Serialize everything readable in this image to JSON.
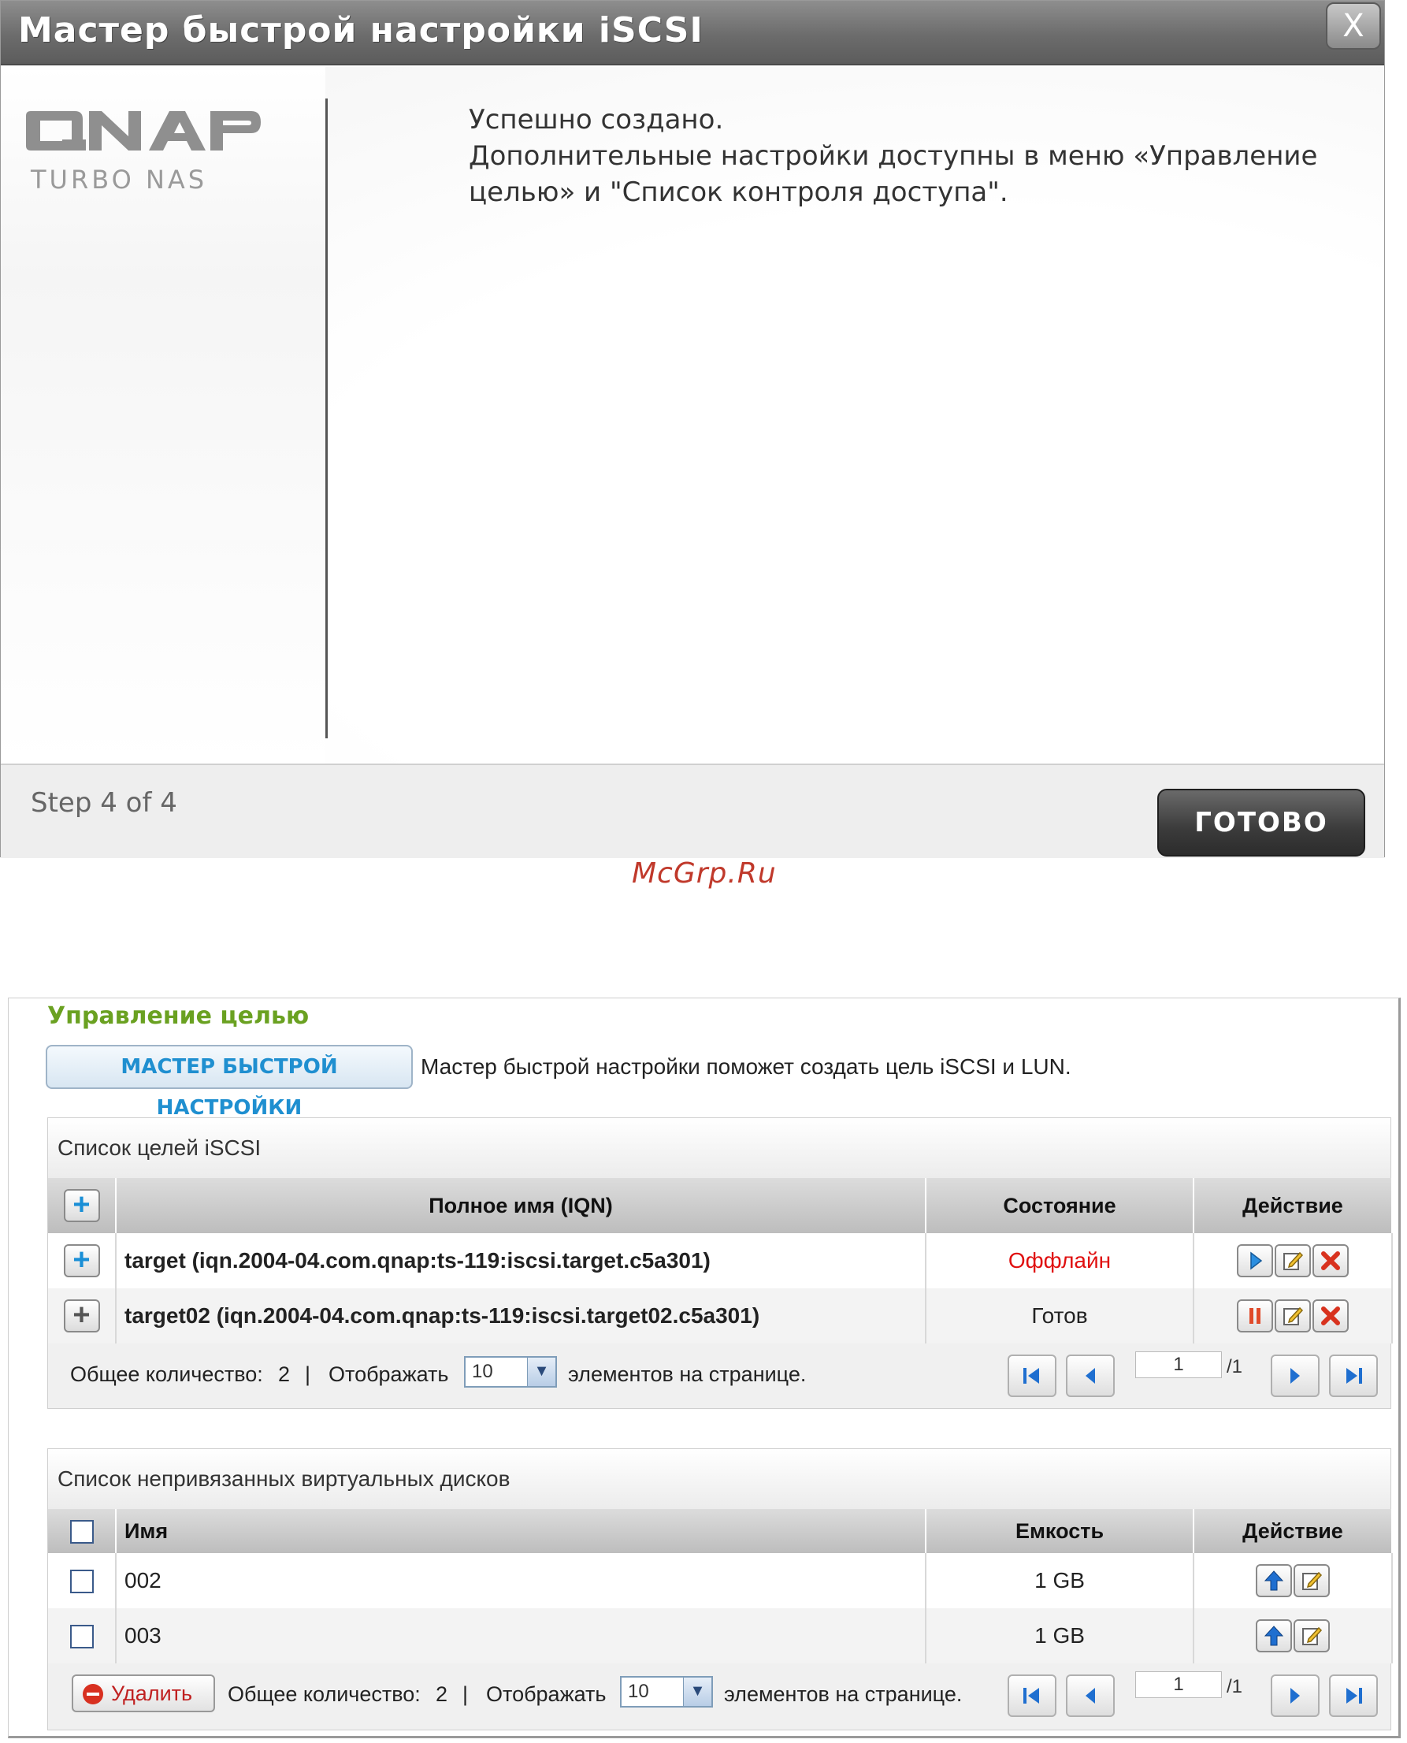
{
  "wizard": {
    "title": "Мастер быстрой настройки iSCSI",
    "close_label": "X",
    "logo_main": "QNAP",
    "logo_sub": "TURBO NAS",
    "message_lines": [
      "Успешно создано.",
      "Дополнительные настройки доступны в меню «Управление",
      "целью» и \"Список контроля доступа\"."
    ],
    "step_text": "Step 4 of 4",
    "done_label": "ГОТОВО"
  },
  "watermark": "McGrp.Ru",
  "target_management": {
    "legend": "Управление целью",
    "wizard_button": "МАСТЕР БЫСТРОЙ НАСТРОЙКИ",
    "wizard_desc": "Мастер быстрой настройки поможет создать цель iSCSI и LUN.",
    "targets": {
      "caption": "Список целей iSCSI",
      "columns": [
        "Полное имя (IQN)",
        "Состояние",
        "Действие"
      ],
      "rows": [
        {
          "name": "target (iqn.2004-04.com.qnap:ts-119:iscsi.target.c5a301)",
          "status": "Оффлайн",
          "status_color": "#e01010",
          "expand": "+"
        },
        {
          "name": "target02 (iqn.2004-04.com.qnap:ts-119:iscsi.target02.c5a301)",
          "status": "Готов",
          "status_color": "#222222",
          "expand": "+"
        }
      ],
      "pager": {
        "total_label": "Общее количество:",
        "total": "2",
        "sep": "|",
        "show_label": "Отображать",
        "per_page": "10",
        "per_page_suffix": "элементов на странице.",
        "page": "1",
        "of": "/1"
      }
    },
    "luns": {
      "caption": "Список непривязанных виртуальных дисков",
      "columns": [
        "Имя",
        "Емкость",
        "Действие"
      ],
      "rows": [
        {
          "name": "002",
          "capacity": "1 GB"
        },
        {
          "name": "003",
          "capacity": "1 GB"
        }
      ],
      "delete_label": "Удалить",
      "pager": {
        "total_label": "Общее количество:",
        "total": "2",
        "sep": "|",
        "show_label": "Отображать",
        "per_page": "10",
        "per_page_suffix": "элементов на странице.",
        "page": "1",
        "of": "/1"
      }
    }
  }
}
